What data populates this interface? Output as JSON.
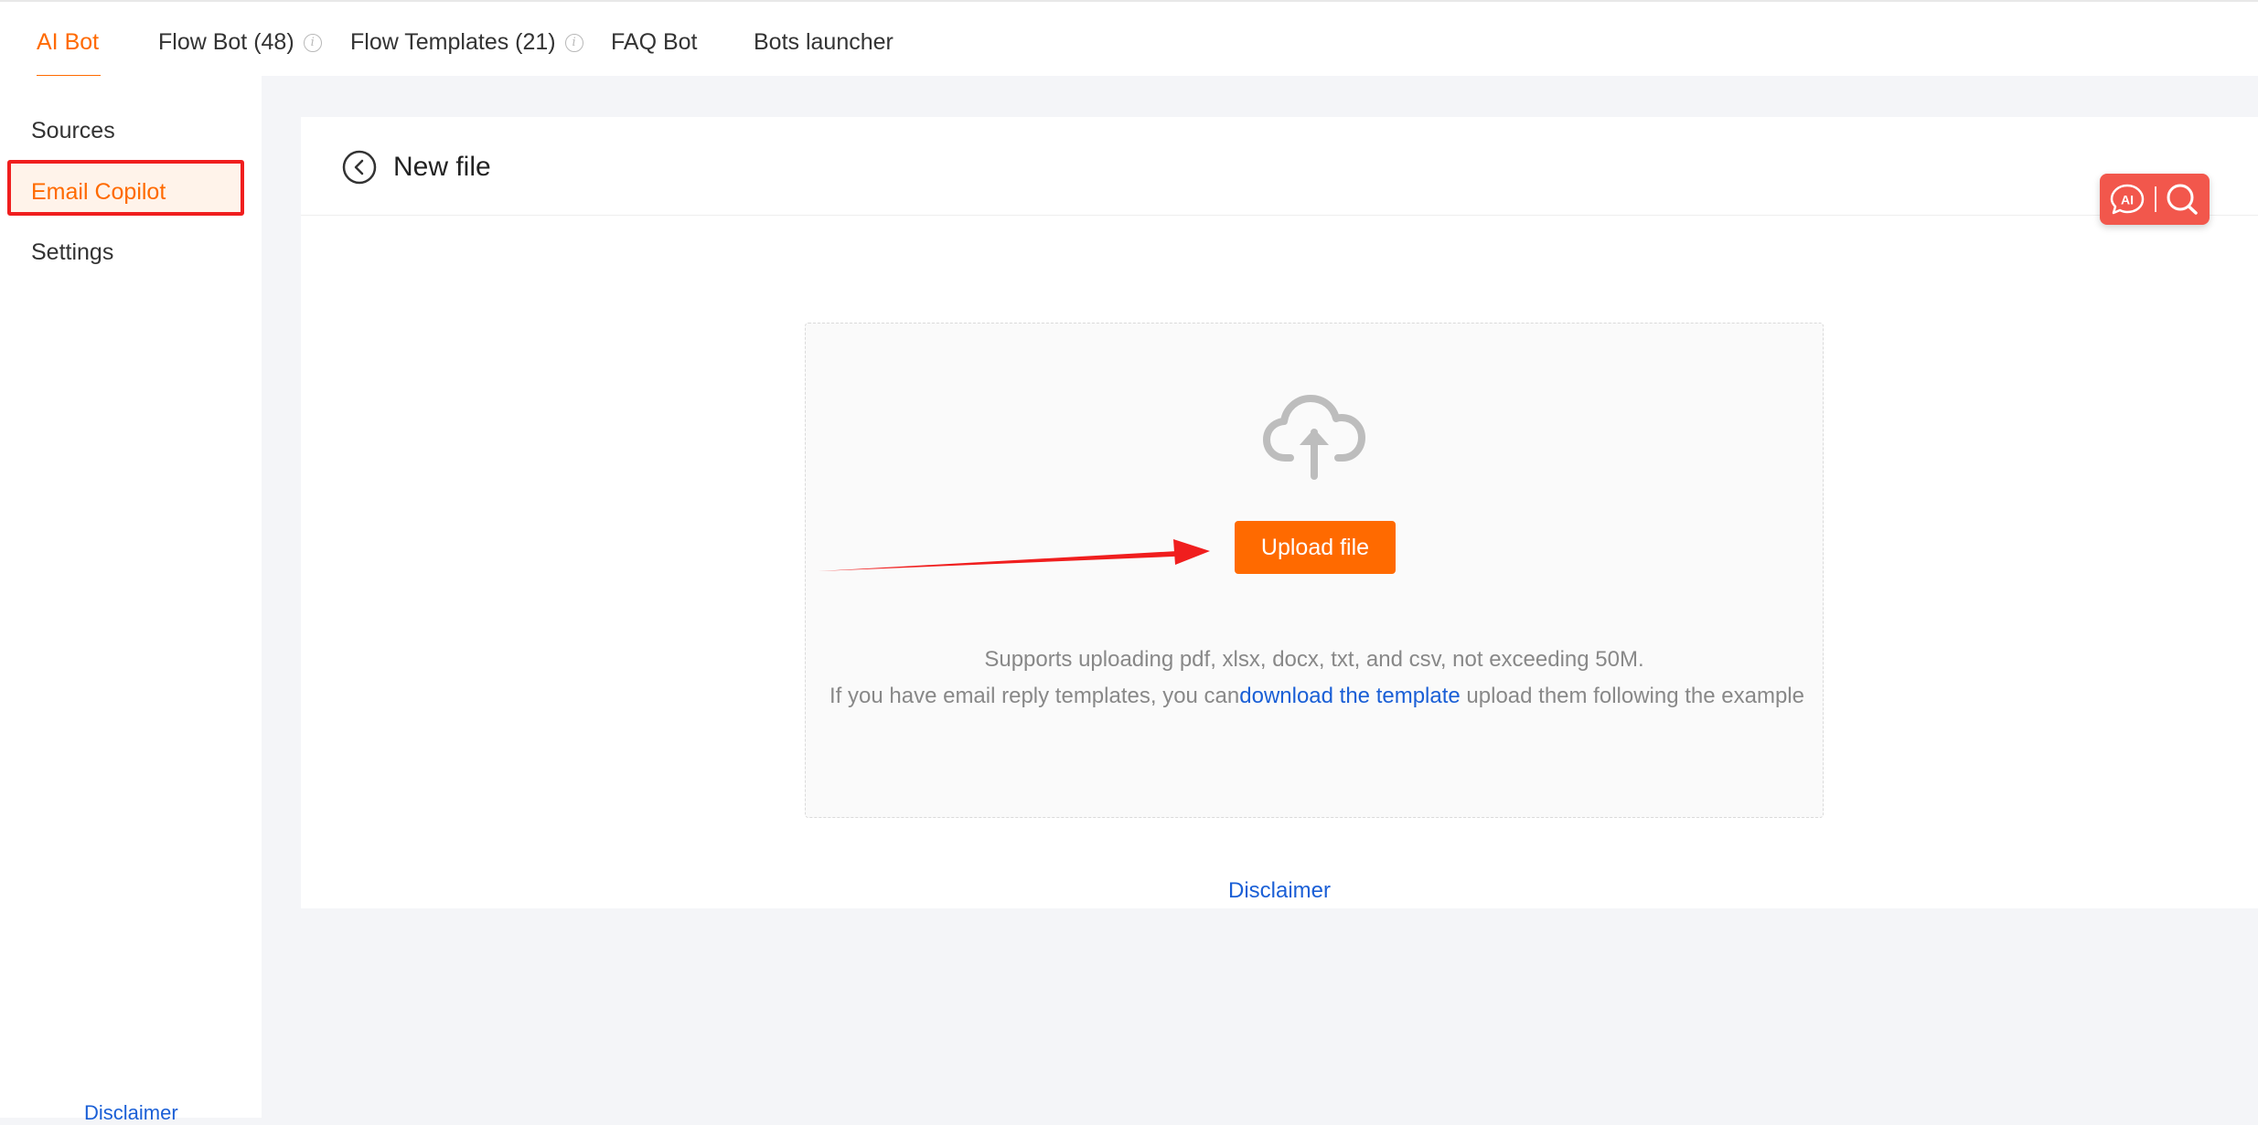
{
  "tabs": [
    {
      "label": "AI Bot",
      "active": true
    },
    {
      "label": "Flow Bot (48)",
      "info": true
    },
    {
      "label": "Flow Templates (21)",
      "info": true
    },
    {
      "label": "FAQ Bot"
    },
    {
      "label": "Bots launcher"
    }
  ],
  "sidebar": {
    "items": [
      {
        "label": "Sources"
      },
      {
        "label": "Email Copilot",
        "active": true
      },
      {
        "label": "Settings"
      }
    ],
    "disclaimer": "Disclaimer"
  },
  "page": {
    "title": "New file"
  },
  "ai_widget": {
    "label": "AI"
  },
  "upload": {
    "button_label": "Upload file",
    "support_text": "Supports uploading pdf, xlsx, docx, txt, and csv, not exceeding 50M.",
    "template_prefix": "If you have email reply templates, you can",
    "template_link": "download the template",
    "template_suffix": " upload them following the example"
  },
  "disclaimer": "Disclaimer",
  "colors": {
    "accent": "#ff6a00",
    "link": "#1a5fd6",
    "highlight_border": "#f01e1e",
    "widget": "#f2574c"
  }
}
